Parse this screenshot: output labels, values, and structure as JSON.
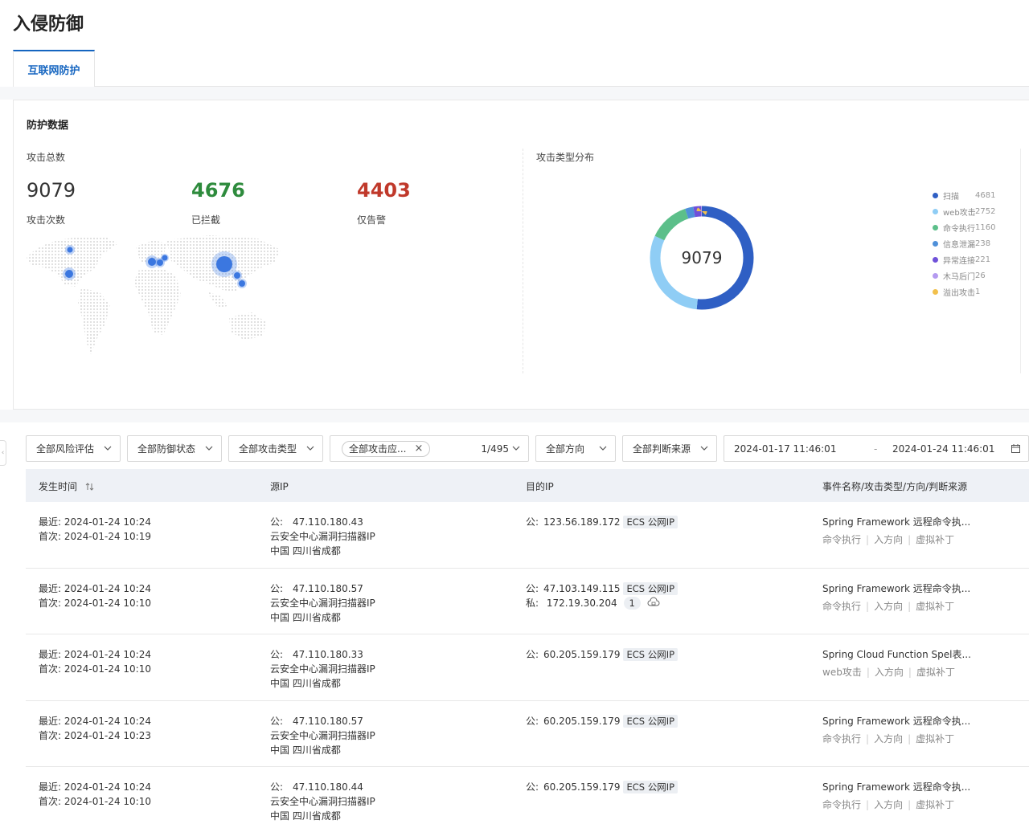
{
  "page": {
    "title": "入侵防御"
  },
  "tabs": [
    {
      "label": "互联网防护"
    }
  ],
  "stats": {
    "title": "防护数据",
    "total_label": "攻击总数",
    "items": [
      {
        "value": "9079",
        "label": "攻击次数",
        "color": "#333333"
      },
      {
        "value": "4676",
        "label": "已拦截",
        "color": "#2e8b3d"
      },
      {
        "value": "4403",
        "label": "仅告警",
        "color": "#c0392b"
      }
    ],
    "distribution_label": "攻击类型分布",
    "donut_center": "9079",
    "legend": [
      {
        "name": "扫描",
        "value": "4681",
        "color": "#2f5fc4"
      },
      {
        "name": "web攻击",
        "value": "2752",
        "color": "#8fcdf5"
      },
      {
        "name": "命令执行",
        "value": "1160",
        "color": "#5cbf8a"
      },
      {
        "name": "信息泄漏",
        "value": "238",
        "color": "#4f90d9"
      },
      {
        "name": "异常连接",
        "value": "221",
        "color": "#6f51d9"
      },
      {
        "name": "木马后门",
        "value": "26",
        "color": "#b49af0"
      },
      {
        "name": "溢出攻击",
        "value": "1",
        "color": "#f2c04c"
      }
    ]
  },
  "filters": {
    "risk": "全部风险评估",
    "defense_status": "全部防御状态",
    "attack_type": "全部攻击类型",
    "attack_app_tag": "全部攻击应...",
    "attack_app_count": "1/495",
    "direction": "全部方向",
    "judge_source": "全部判断来源",
    "date_start": "2024-01-17 11:46:01",
    "date_sep": "-",
    "date_end": "2024-01-24 11:46:01"
  },
  "table": {
    "headers": {
      "time": "发生时间",
      "src": "源IP",
      "dst": "目的IP",
      "event": "事件名称/攻击类型/方向/判断来源"
    },
    "rows": [
      {
        "latest": "最近: 2024-01-24 10:24",
        "first": "首次: 2024-01-24 10:19",
        "src_prefix": "公:",
        "src_ip": "47.110.180.43",
        "src_desc": "云安全中心漏洞扫描器IP",
        "src_loc": "中国  四川省成都",
        "dst_prefix": "公:",
        "dst_ip": "123.56.189.172",
        "dst_tag": "ECS 公网IP",
        "event": "Spring Framework 远程命令执...",
        "type": "命令执行",
        "direction": "入方向",
        "source": "虚拟补丁"
      },
      {
        "latest": "最近: 2024-01-24 10:24",
        "first": "首次: 2024-01-24 10:10",
        "src_prefix": "公:",
        "src_ip": "47.110.180.57",
        "src_desc": "云安全中心漏洞扫描器IP",
        "src_loc": "中国  四川省成都",
        "dst_prefix": "公:",
        "dst_ip": "47.103.149.115",
        "dst_tag": "ECS 公网IP",
        "dst2_prefix": "私:",
        "dst2_ip": "172.19.30.204",
        "dst2_count": "1",
        "event": "Spring Framework 远程命令执...",
        "type": "命令执行",
        "direction": "入方向",
        "source": "虚拟补丁"
      },
      {
        "latest": "最近: 2024-01-24 10:24",
        "first": "首次: 2024-01-24 10:10",
        "src_prefix": "公:",
        "src_ip": "47.110.180.33",
        "src_desc": "云安全中心漏洞扫描器IP",
        "src_loc": "中国  四川省成都",
        "dst_prefix": "公:",
        "dst_ip": "60.205.159.179",
        "dst_tag": "ECS 公网IP",
        "event": "Spring Cloud Function Spel表...",
        "type": "web攻击",
        "direction": "入方向",
        "source": "虚拟补丁"
      },
      {
        "latest": "最近: 2024-01-24 10:24",
        "first": "首次: 2024-01-24 10:23",
        "src_prefix": "公:",
        "src_ip": "47.110.180.57",
        "src_desc": "云安全中心漏洞扫描器IP",
        "src_loc": "中国  四川省成都",
        "dst_prefix": "公:",
        "dst_ip": "60.205.159.179",
        "dst_tag": "ECS 公网IP",
        "event": "Spring Framework 远程命令执...",
        "type": "命令执行",
        "direction": "入方向",
        "source": "虚拟补丁"
      },
      {
        "latest": "最近: 2024-01-24 10:24",
        "first": "首次: 2024-01-24 10:10",
        "src_prefix": "公:",
        "src_ip": "47.110.180.44",
        "src_desc": "云安全中心漏洞扫描器IP",
        "src_loc": "中国  四川省成都",
        "dst_prefix": "公:",
        "dst_ip": "60.205.159.179",
        "dst_tag": "ECS 公网IP",
        "event": "Spring Framework 远程命令执...",
        "type": "命令执行",
        "direction": "入方向",
        "source": "虚拟补丁"
      }
    ]
  }
}
